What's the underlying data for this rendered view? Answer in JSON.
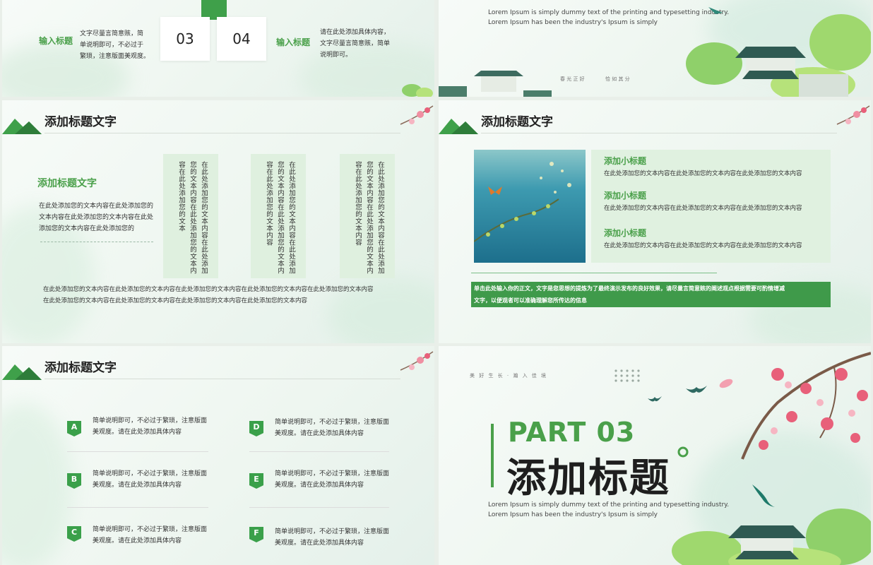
{
  "slide1": {
    "left_heading": "输入标题",
    "left_text_lines": [
      "文字尽量言简意赅，简",
      "单说明即可，不必过于",
      "繁琐，注意版面美观度。"
    ],
    "num_a": "03",
    "num_b": "04",
    "right_heading": "输入标题",
    "right_text_lines": [
      "请在此处添加具体内容，",
      "文字尽量言简意赅，简单",
      "说明即可。"
    ]
  },
  "slide2": {
    "lorem_lines": [
      "Lorem Ipsum is simply dummy text of the printing and typesetting industry.",
      "Lorem Ipsum has been the industry's Ipsum is simply"
    ],
    "motto_left": "春 光 正 好",
    "motto_right": "恰 如 其 分"
  },
  "slide3": {
    "title": "添加标题文字",
    "sub_heading": "添加标题文字",
    "para_lines": [
      "在此处添加您的文本内容在此处添加您的",
      "文本内容在此处添加您的文本内容在此处",
      "添加您的文本内容在此处添加您的"
    ],
    "columns": [
      [
        "在此处添加您的文本内容在此处添加",
        "您的文本内容在此处添加您的文本内",
        "容在此处添加您的文本"
      ],
      [
        "在此处添加您的文本内容在此处添加",
        "您的文本内容在此处添加您的文本内",
        "容在此处添加您的文本内容"
      ],
      [
        "在此处添加您的文本内容在此处添加",
        "您的文本内容在此处添加您的文本内",
        "容在此处添加您的文本内容"
      ]
    ],
    "bottom_lines": [
      "在此处添加您的文本内容在此处添加您的文本内容在此处添加您的文本内容在此处添加您的文本内容在此处添加您的文本内容",
      "在此处添加您的文本内容在此处添加您的文本内容在此处添加您的文本内容在此处添加您的文本内容"
    ]
  },
  "slide4": {
    "title": "添加标题文字",
    "items": [
      {
        "heading": "添加小标题",
        "text": "在此处添加您的文本内容在此处添加您的文本内容在此处添加您的文本内容"
      },
      {
        "heading": "添加小标题",
        "text": "在此处添加您的文本内容在此处添加您的文本内容在此处添加您的文本内容"
      },
      {
        "heading": "添加小标题",
        "text": "在此处添加您的文本内容在此处添加您的文本内容在此处添加您的文本内容"
      }
    ],
    "banner_lines": [
      "单击此处输入你的正文，文字是您思想的提炼为了最终演示发布的良好效果，请尽量言简意赅的阐述观点根据需要可酌情增减",
      "文字，以便观者可以准确理解您所传达的信息"
    ]
  },
  "slide5": {
    "title": "添加标题文字",
    "items": [
      {
        "letter": "A",
        "lines": [
          "简单说明即可，不必过于繁琐，注意版面",
          "美观度。请在此处添加具体内容"
        ]
      },
      {
        "letter": "B",
        "lines": [
          "简单说明即可，不必过于繁琐，注意版面",
          "美观度。请在此处添加具体内容"
        ]
      },
      {
        "letter": "C",
        "lines": [
          "简单说明即可，不必过于繁琐，注意版面",
          "美观度。请在此处添加具体内容"
        ]
      },
      {
        "letter": "D",
        "lines": [
          "简单说明即可，不必过于繁琐，注意版面",
          "美观度。请在此处添加具体内容"
        ]
      },
      {
        "letter": "E",
        "lines": [
          "简单说明即可，不必过于繁琐，注意版面",
          "美观度。请在此处添加具体内容"
        ]
      },
      {
        "letter": "F",
        "lines": [
          "简单说明即可，不必过于繁琐，注意版面",
          "美观度。请在此处添加具体内容"
        ]
      }
    ]
  },
  "slide6": {
    "tagline": "美 好 生 长 · 瀚 入 佳 境",
    "part": "PART 03",
    "title": "添加标题",
    "lorem_lines": [
      "Lorem Ipsum is simply dummy text of the printing and typesetting industry.",
      "Lorem Ipsum has been the industry's Ipsum is simply"
    ]
  },
  "colors": {
    "accent": "#4aa04a",
    "dark_green": "#2e7d3a",
    "banner": "#3f9a4a",
    "blossom": "#e8607a"
  }
}
